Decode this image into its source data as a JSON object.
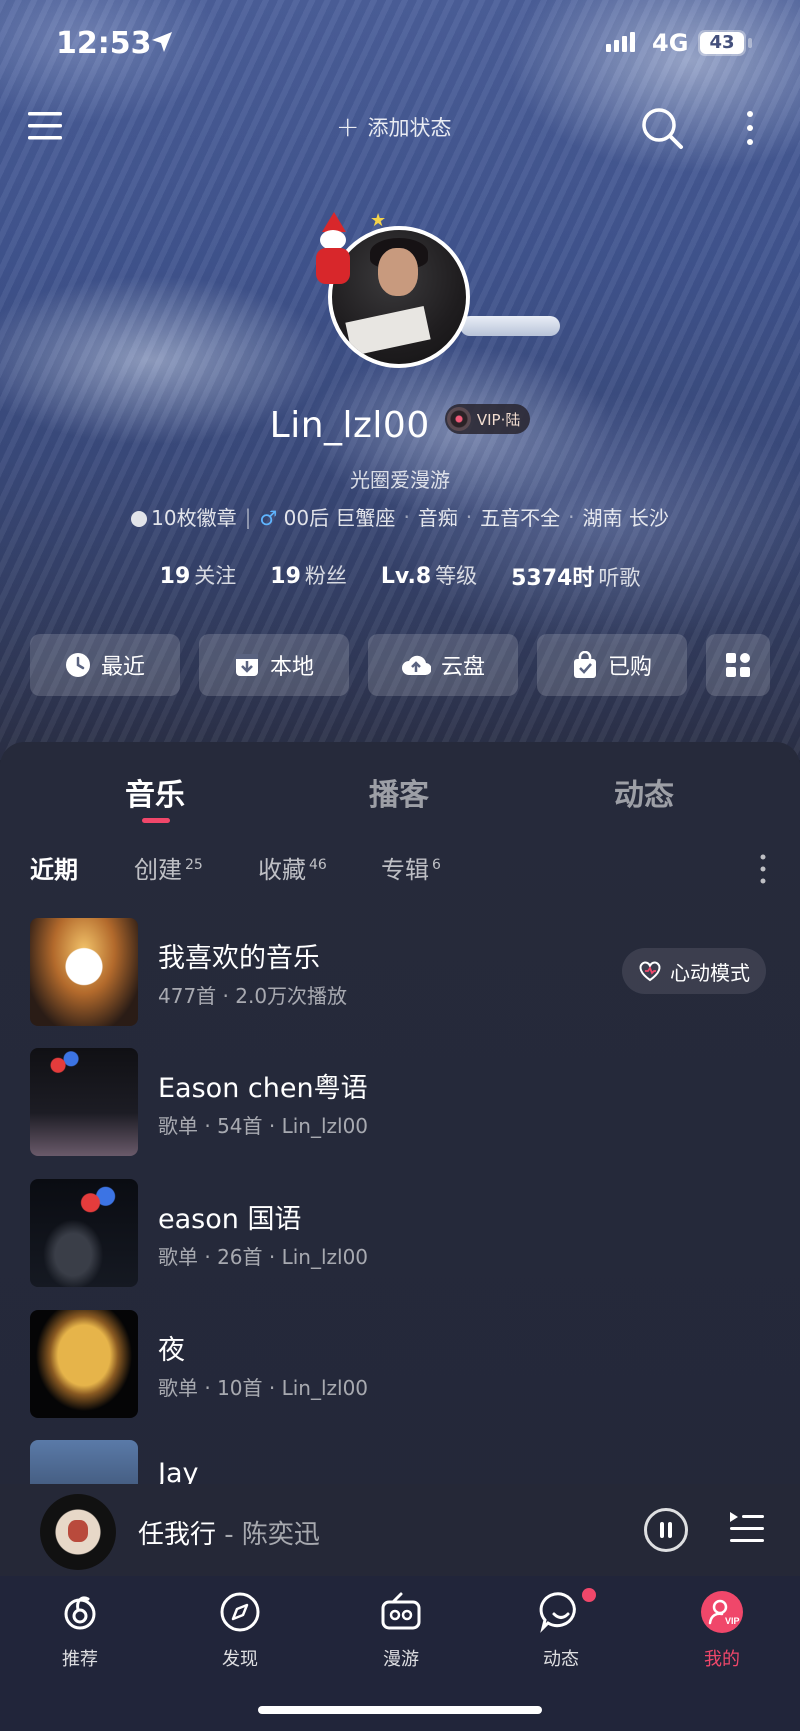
{
  "status_bar": {
    "time": "12:53",
    "network": "4G",
    "battery": "43"
  },
  "top_bar": {
    "add_status": "添加状态"
  },
  "profile": {
    "username": "Lin_lzl00",
    "vip": "VIP·陆",
    "signature": "光圈爱漫游",
    "badges": "10枚徽章",
    "tags": [
      "00后 巨蟹座",
      "音痴",
      "五音不全",
      "湖南 长沙"
    ],
    "stats": [
      {
        "value": "19",
        "label": "关注"
      },
      {
        "value": "19",
        "label": "粉丝"
      },
      {
        "value": "Lv.8",
        "label": "等级"
      },
      {
        "value": "5374时",
        "label": "听歌"
      }
    ]
  },
  "quick_buttons": {
    "recent": "最近",
    "local": "本地",
    "cloud": "云盘",
    "purchased": "已购"
  },
  "tabs": {
    "music": "音乐",
    "podcast": "播客",
    "moments": "动态"
  },
  "subtabs": {
    "recent": "近期",
    "created": "创建",
    "created_count": "25",
    "collected": "收藏",
    "collected_count": "46",
    "album": "专辑",
    "album_count": "6"
  },
  "playlists": [
    {
      "title": "我喜欢的音乐",
      "sub": "477首 · 2.0万次播放"
    },
    {
      "title": "Eason chen粤语",
      "sub": "歌单 · 54首 · Lin_lzl00"
    },
    {
      "title": "eason 国语",
      "sub": "歌单 · 26首 · Lin_lzl00"
    },
    {
      "title": "夜",
      "sub": "歌单 · 10首 · Lin_lzl00"
    },
    {
      "title": "Jay",
      "sub": ""
    }
  ],
  "heart_mode": "心动模式",
  "player": {
    "song": "任我行",
    "artist": " - 陈奕迅"
  },
  "bottom_nav": {
    "recommend": "推荐",
    "discover": "发现",
    "roam": "漫游",
    "moments": "动态",
    "mine": "我的"
  },
  "colors": {
    "accent": "#f0476a",
    "panel": "#262a3b",
    "hero": "#4b5f9a"
  }
}
